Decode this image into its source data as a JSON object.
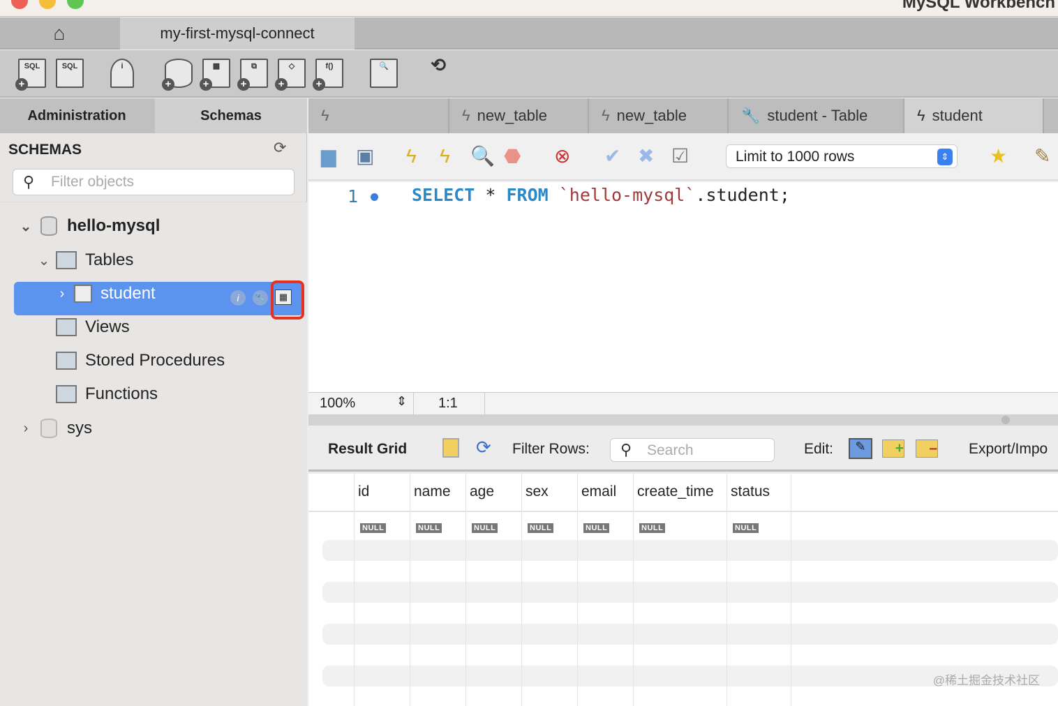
{
  "window": {
    "title": "MySQL Workbench"
  },
  "connection_tab": {
    "home_icon": "home-icon",
    "label": "my-first-mysql-connect"
  },
  "sidebar": {
    "tabs": [
      "Administration",
      "Schemas"
    ],
    "heading": "SCHEMAS",
    "filter_placeholder": "Filter objects",
    "tree": {
      "schema": "hello-mysql",
      "tables": "Tables",
      "table": "student",
      "views": "Views",
      "procedures": "Stored Procedures",
      "functions": "Functions",
      "other_schema": "sys"
    }
  },
  "query_tabs": [
    {
      "label": ""
    },
    {
      "label": "new_table"
    },
    {
      "label": "new_table"
    },
    {
      "label": "student - Table"
    },
    {
      "label": "student"
    }
  ],
  "query_toolbar": {
    "limit": "Limit to 1000 rows"
  },
  "editor": {
    "line": "1",
    "sql": {
      "kw1": "SELECT",
      "star": " * ",
      "kw2": "FROM",
      "schema": " `hello-mysql`",
      "rest": ".student;"
    }
  },
  "status": {
    "zoom": "100%",
    "position": "1:1"
  },
  "results": {
    "title": "Result Grid",
    "filter_label": "Filter Rows:",
    "search_placeholder": "Search",
    "edit_label": "Edit:",
    "export_label": "Export/Impo",
    "columns": [
      "id",
      "name",
      "age",
      "sex",
      "email",
      "create_time",
      "status"
    ],
    "null_label": "NULL"
  },
  "watermark": "@稀土掘金技术社区",
  "colors": {
    "selection": "#5b93ee",
    "highlight_box": "#e53222",
    "keyword": "#2d88c8",
    "string": "#a03a3a"
  }
}
